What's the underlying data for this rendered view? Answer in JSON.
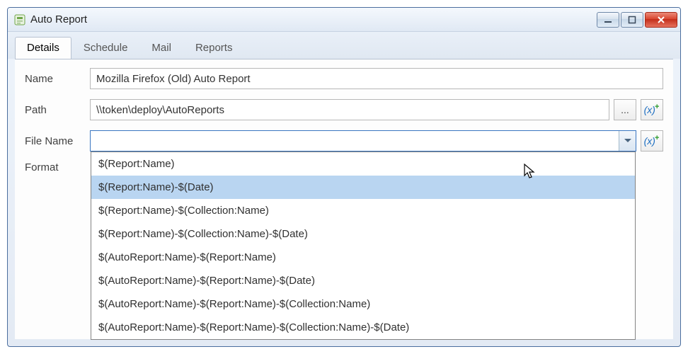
{
  "window": {
    "title": "Auto Report"
  },
  "tabs": {
    "details": "Details",
    "schedule": "Schedule",
    "mail": "Mail",
    "reports": "Reports"
  },
  "labels": {
    "name": "Name",
    "path": "Path",
    "file_name": "File Name",
    "format": "Format"
  },
  "fields": {
    "name": "Mozilla Firefox (Old) Auto Report",
    "path": "\\\\token\\deploy\\AutoReports",
    "file_name": ""
  },
  "dropdown": {
    "items": [
      "$(Report:Name)",
      "$(Report:Name)-$(Date)",
      "$(Report:Name)-$(Collection:Name)",
      "$(Report:Name)-$(Collection:Name)-$(Date)",
      "$(AutoReport:Name)-$(Report:Name)",
      "$(AutoReport:Name)-$(Report:Name)-$(Date)",
      "$(AutoReport:Name)-$(Report:Name)-$(Collection:Name)",
      "$(AutoReport:Name)-$(Report:Name)-$(Collection:Name)-$(Date)"
    ],
    "selected_index": 1
  },
  "buttons": {
    "browse": "...",
    "var_insert": "(x)"
  }
}
